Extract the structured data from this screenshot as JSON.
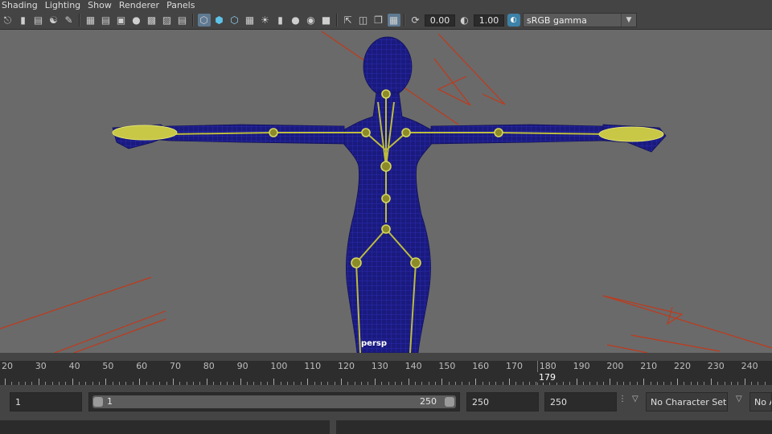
{
  "menu": [
    "Shading",
    "Lighting",
    "Show",
    "Renderer",
    "Panels"
  ],
  "toolbar": {
    "icons_left": [
      "camera-select-icon",
      "bookmark-icon",
      "image-plane-icon",
      "camera-attr-icon",
      "grease-pencil-icon"
    ],
    "icons_mid": [
      "grid-icon",
      "film-gate-icon",
      "resolution-gate-icon",
      "gate-mask-icon",
      "field-chart-icon",
      "safe-action-icon",
      "safe-title-icon"
    ],
    "icons_shade": [
      "wireframe-icon",
      "smooth-shade-icon",
      "wireframe-on-shaded-icon",
      "textured-icon",
      "use-lights-icon",
      "shadows-icon",
      "ambient-occlusion-icon",
      "motion-blur-icon",
      "antialias-icon"
    ],
    "icons_right": [
      "isolate-select-icon",
      "xray-icon",
      "xray-joints-icon",
      "backface-icon"
    ],
    "exposure_value": "0.00",
    "gamma_value": "1.00",
    "color_space": "sRGB gamma"
  },
  "viewport": {
    "camera_label": "persp",
    "background_color": "#6a6a6a",
    "mesh_color": "#1c1c8c",
    "joint_color": "#c8c846"
  },
  "timeline": {
    "labels": [
      "20",
      "30",
      "40",
      "50",
      "60",
      "70",
      "80",
      "90",
      "100",
      "110",
      "120",
      "130",
      "140",
      "150",
      "160",
      "170",
      "180",
      "190",
      "200",
      "210",
      "220",
      "230",
      "240"
    ],
    "current_frame": "179"
  },
  "range": {
    "start_field": "1",
    "slider_start": "1",
    "slider_end": "250",
    "end_field": "250",
    "max_field": "250",
    "character_set": "No Character Set",
    "anim_layer": "No A"
  }
}
